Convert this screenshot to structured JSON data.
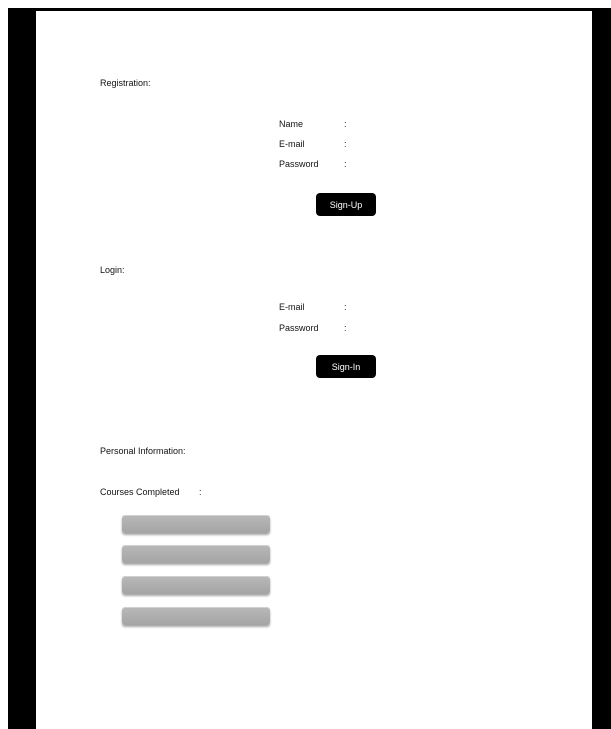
{
  "registration": {
    "heading": "Registration:",
    "name_label": "Name",
    "email_label": "E-mail",
    "password_label": "Password",
    "colon": ":",
    "signup_label": "Sign-Up"
  },
  "login": {
    "heading": "Login:",
    "email_label": "E-mail",
    "password_label": "Password",
    "colon": ":",
    "signin_label": "Sign-In"
  },
  "personal": {
    "heading": "Personal Information:",
    "courses_label": "Courses Completed",
    "colon": ":"
  }
}
